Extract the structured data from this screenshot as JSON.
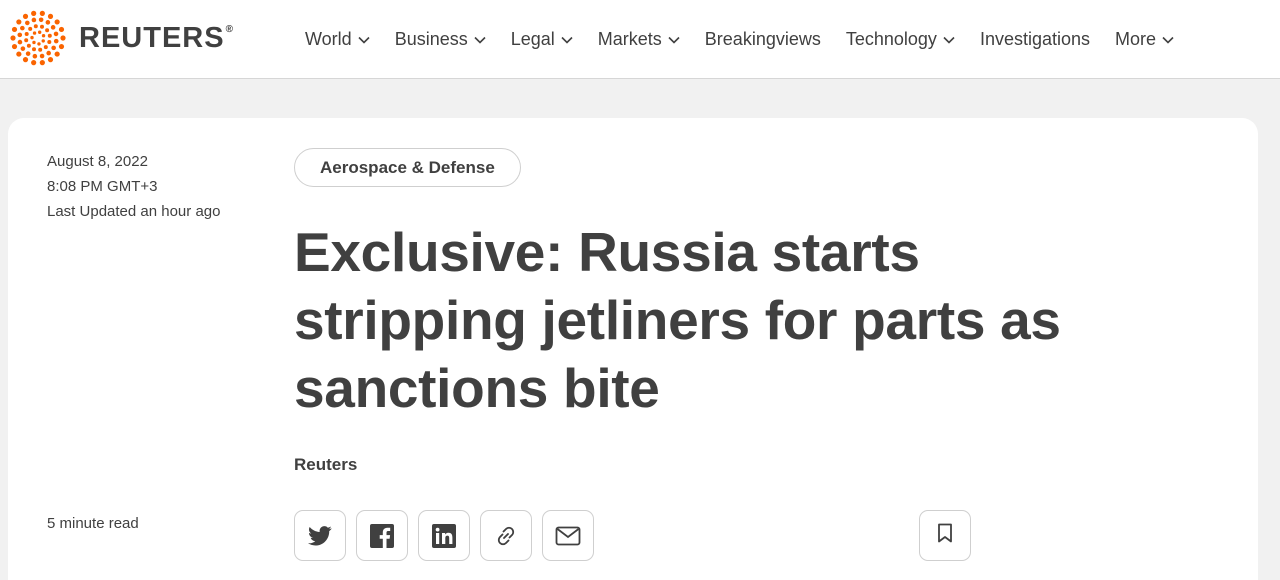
{
  "brand": {
    "name": "REUTERS",
    "registered_mark": "®",
    "logo_color": "#fa6400"
  },
  "nav": {
    "items": [
      {
        "label": "World",
        "dropdown": true
      },
      {
        "label": "Business",
        "dropdown": true
      },
      {
        "label": "Legal",
        "dropdown": true
      },
      {
        "label": "Markets",
        "dropdown": true
      },
      {
        "label": "Breakingviews",
        "dropdown": false
      },
      {
        "label": "Technology",
        "dropdown": true
      },
      {
        "label": "Investigations",
        "dropdown": false
      },
      {
        "label": "More",
        "dropdown": true
      }
    ]
  },
  "article": {
    "date": "August 8, 2022",
    "time": "8:08 PM GMT+3",
    "updated": "Last Updated an hour ago",
    "category": "Aerospace & Defense",
    "headline": "Exclusive: Russia starts stripping jetliners for parts as sanctions bite",
    "byline": "Reuters",
    "read_time": "5 minute read"
  },
  "share": {
    "buttons": [
      {
        "icon": "twitter-icon"
      },
      {
        "icon": "facebook-icon"
      },
      {
        "icon": "linkedin-icon"
      },
      {
        "icon": "link-icon"
      },
      {
        "icon": "email-icon"
      }
    ],
    "bookmark_icon": "bookmark-icon"
  }
}
